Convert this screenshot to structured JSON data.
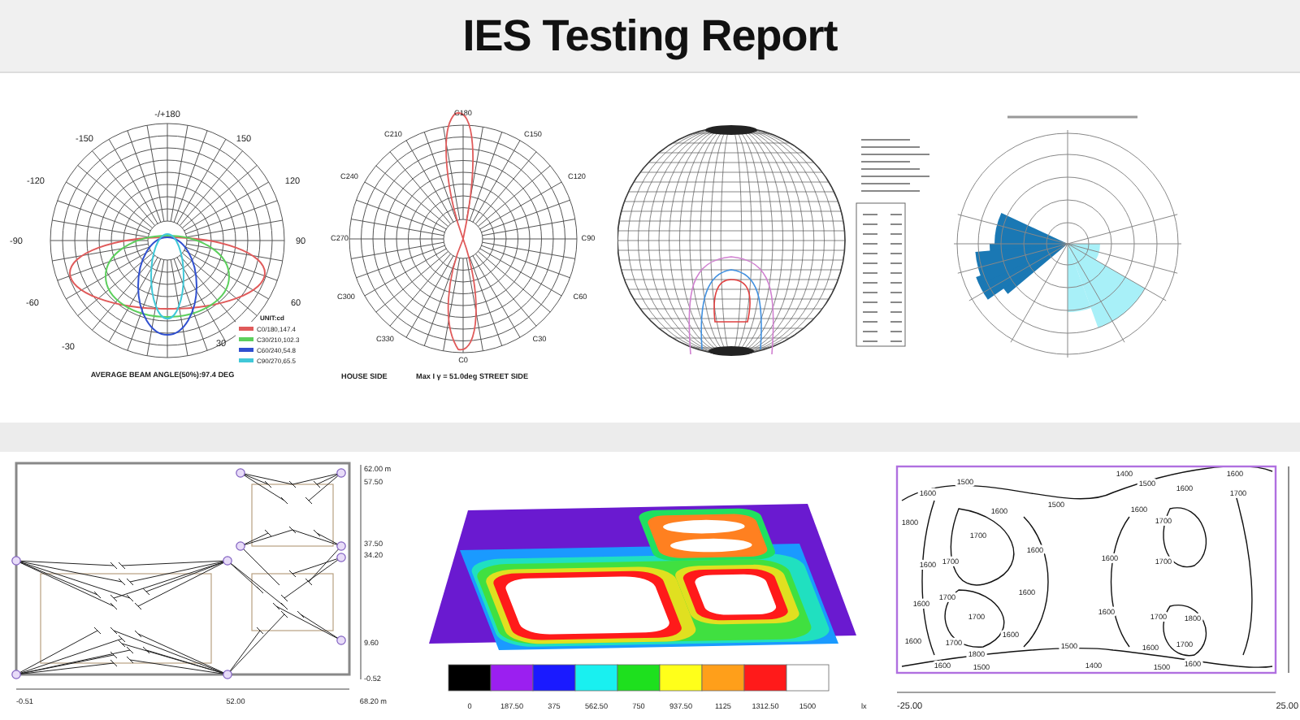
{
  "title": "IES Testing Report",
  "polar_diagram": {
    "angle_labels": [
      "-/+180",
      "-150",
      "150",
      "-120",
      "120",
      "-90",
      "90",
      "-60",
      "60",
      "-30",
      "30"
    ],
    "legend_title": "UNIT:cd",
    "legend": [
      {
        "label": "C0/180,147.4",
        "color": "#e05a5a"
      },
      {
        "label": "C30/210,102.3",
        "color": "#5ccf5c"
      },
      {
        "label": "C60/240,54.8",
        "color": "#3050d0"
      },
      {
        "label": "C90/270,65.5",
        "color": "#40c8d8"
      }
    ],
    "caption": "AVERAGE BEAM ANGLE(50%):97.4 DEG"
  },
  "plane_diagram": {
    "angle_labels": [
      "C180",
      "C210",
      "C150",
      "C240",
      "C120",
      "C270",
      "C90",
      "C300",
      "C60",
      "C330",
      "C30",
      "C0"
    ],
    "left_caption": "HOUSE SIDE",
    "right_caption": "Max I γ = 51.0deg STREET SIDE"
  },
  "layout_plan": {
    "y_labels": [
      "62.00 m",
      "57.50",
      "37.50",
      "34.20",
      "9.60",
      "-0.52"
    ],
    "x_labels": [
      "-0.51",
      "52.00",
      "68.20 m"
    ]
  },
  "illuminance_scale": {
    "steps": [
      {
        "label": "0",
        "color": "#000000"
      },
      {
        "label": "187.50",
        "color": "#9b1ff0"
      },
      {
        "label": "375",
        "color": "#1a1aff"
      },
      {
        "label": "562.50",
        "color": "#19f0f0"
      },
      {
        "label": "750",
        "color": "#1ee01e"
      },
      {
        "label": "937.50",
        "color": "#ffff1a"
      },
      {
        "label": "1125",
        "color": "#ff9f1a"
      },
      {
        "label": "1312.50",
        "color": "#ff1a1a"
      },
      {
        "label": "1500",
        "color": "#ffffff"
      }
    ],
    "unit": "lx"
  },
  "contour_plot": {
    "contour_labels": [
      "1600",
      "1500",
      "1400",
      "1500",
      "1600",
      "1600",
      "1700",
      "1800",
      "1600",
      "1500",
      "1600",
      "1700",
      "1600",
      "1700",
      "1700",
      "1600",
      "1600",
      "1700",
      "1600",
      "1700",
      "1700",
      "1600",
      "1600",
      "1700",
      "1800",
      "1600",
      "1700",
      "1800",
      "1600",
      "1500",
      "1600",
      "1700",
      "1600",
      "1500",
      "1400",
      "1500",
      "1600"
    ],
    "x_labels": [
      "-25.00",
      "25.00"
    ]
  }
}
